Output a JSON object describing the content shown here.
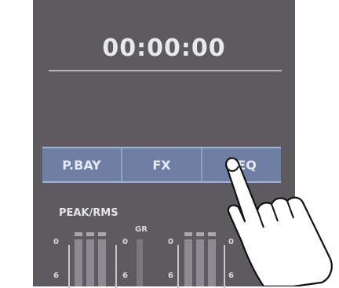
{
  "display": {
    "timecode": "00:00:00"
  },
  "tabs": [
    {
      "label": "P.BAY"
    },
    {
      "label": "FX"
    },
    {
      "label": "GEQ"
    }
  ],
  "meter": {
    "title": "PEAK/RMS",
    "gr_label": "GR",
    "scale_top": "0",
    "scale_mid": "6"
  },
  "colors": {
    "panel": "#5e5b60",
    "tab_bg": "#6f7fa3",
    "tab_border": "#9fb4d8",
    "text": "#e9e8ec"
  }
}
